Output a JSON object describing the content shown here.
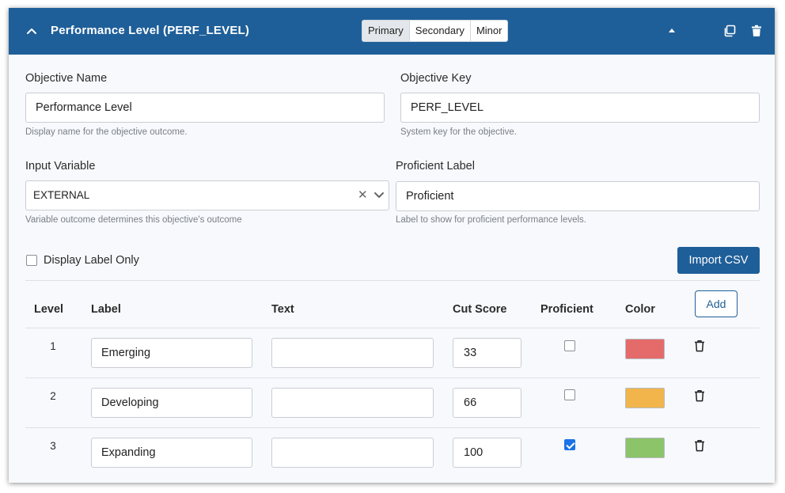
{
  "header": {
    "title": "Performance Level (PERF_LEVEL)",
    "segments": [
      "Primary",
      "Secondary",
      "Minor"
    ]
  },
  "form": {
    "objective_name": {
      "label": "Objective Name",
      "value": "Performance Level",
      "help": "Display name for the objective outcome."
    },
    "objective_key": {
      "label": "Objective Key",
      "value": "PERF_LEVEL",
      "help": "System key for the objective."
    },
    "input_variable": {
      "label": "Input Variable",
      "value": "EXTERNAL",
      "help": "Variable outcome determines this objective's outcome"
    },
    "proficient_label": {
      "label": "Proficient Label",
      "value": "Proficient",
      "help": "Label to show for proficient performance levels."
    },
    "display_label_only": {
      "label": "Display Label Only"
    },
    "import_csv": "Import CSV"
  },
  "table": {
    "headers": {
      "level": "Level",
      "label": "Label",
      "text": "Text",
      "cut_score": "Cut Score",
      "proficient": "Proficient",
      "color": "Color"
    },
    "add_button": "Add",
    "rows": [
      {
        "level": "1",
        "label": "Emerging",
        "text": "",
        "cut_score": "33",
        "proficient": false,
        "color": "#e56b6b"
      },
      {
        "level": "2",
        "label": "Developing",
        "text": "",
        "cut_score": "66",
        "proficient": false,
        "color": "#f2b54b"
      },
      {
        "level": "3",
        "label": "Expanding",
        "text": "",
        "cut_score": "100",
        "proficient": true,
        "color": "#8cc46a"
      }
    ]
  }
}
